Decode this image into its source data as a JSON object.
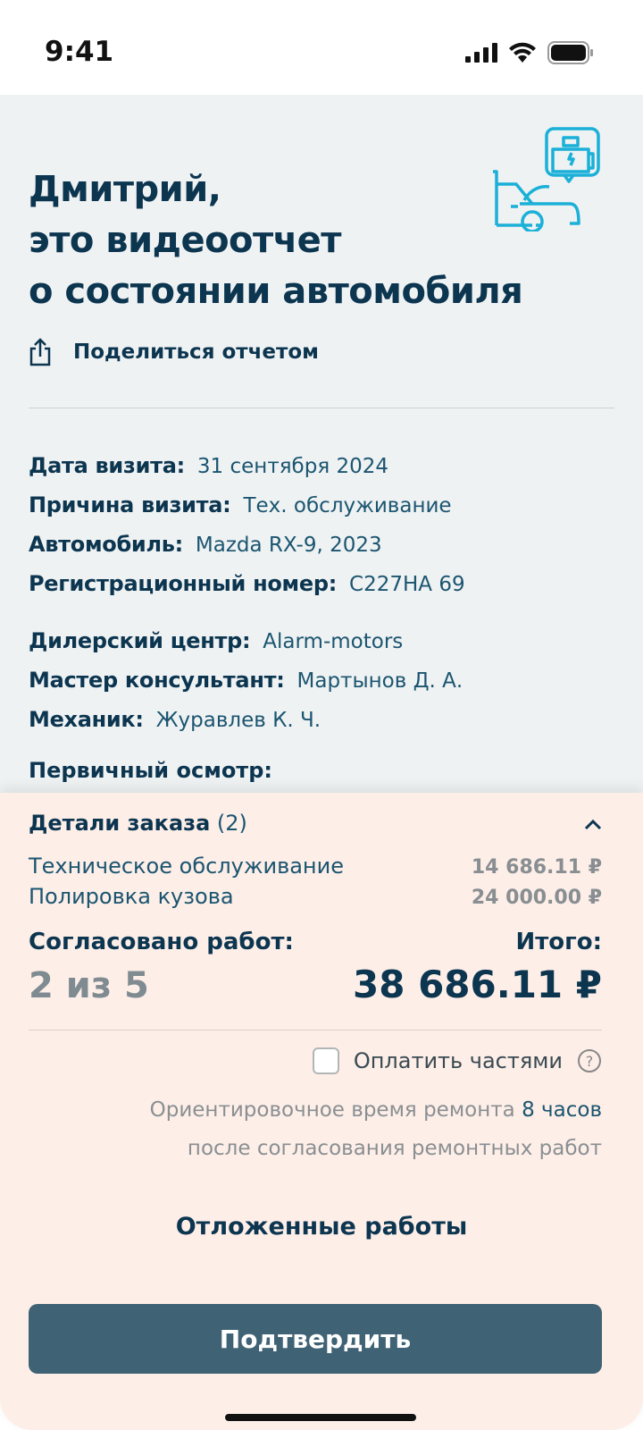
{
  "status_bar": {
    "time": "9:41"
  },
  "header": {
    "title_lines": [
      "Дмитрий,",
      "это видеоотчет",
      "о состоянии автомобиля"
    ],
    "share_label": "Поделиться отчетом"
  },
  "info_group1": [
    {
      "label": "Дата визита:",
      "value": "31 сентября 2024"
    },
    {
      "label": "Причина визита:",
      "value": "Тех. обслуживание"
    },
    {
      "label": "Автомобиль:",
      "value": "Mazda RX-9, 2023"
    },
    {
      "label": "Регистрационный номер:",
      "value": "С227НА 69"
    }
  ],
  "info_group2": [
    {
      "label": "Дилерский центр:",
      "value": "Alarm-motors"
    },
    {
      "label": "Мастер консультант:",
      "value": "Мартынов Д. А."
    },
    {
      "label": "Механик:",
      "value": "Журавлев К. Ч."
    }
  ],
  "cut_section": "Первичный осмотр:",
  "order": {
    "title": "Детали заказа",
    "count": "(2)",
    "items": [
      {
        "name": "Техническое обслуживание",
        "price": "14 686.11 ₽"
      },
      {
        "name": "Полировка кузова",
        "price": "24 000.00 ₽"
      }
    ],
    "agreed_label": "Согласовано работ:",
    "agreed_value": "2 из 5",
    "total_label": "Итого:",
    "total_value": "38 686.11 ₽",
    "installments_label": "Оплатить частями",
    "repair_time_prefix": "Ориентировочное время ремонта",
    "repair_time_value": "8 часов",
    "repair_time_suffix": "после согласования ремонтных работ",
    "deferred_label": "Отложенные работы",
    "confirm_label": "Подтвердить"
  },
  "colors": {
    "accent": "#1ab0d8",
    "primary": "#0c3550",
    "button": "#3f6275",
    "sheet": "#fdeee8",
    "background": "#eff2f3"
  }
}
